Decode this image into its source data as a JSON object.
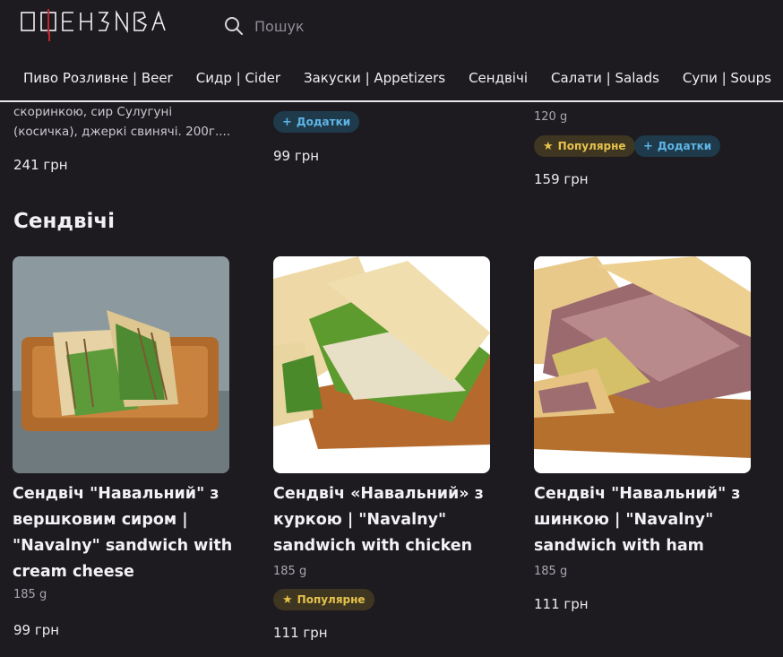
{
  "brand": {
    "logo_text": "ОФЕНЗИВА"
  },
  "search": {
    "placeholder": "Пошук"
  },
  "nav": [
    "Пиво Розливне | Beer",
    "Сидр | Cider",
    "Закуски | Appetizers",
    "Сендвічі",
    "Салати | Salads",
    "Супи | Soups"
  ],
  "prev_items": [
    {
      "desc_line1": "скоринкою, сир Сулугуні",
      "desc_line2": "(косичка), джеркі свинячі. 200г....",
      "price": "241 грн"
    },
    {
      "badge_addon": "Додатки",
      "price": "99 грн"
    },
    {
      "weight": "120 g",
      "badge_popular": "Популярне",
      "badge_addon": "Додатки",
      "price": "159 грн"
    }
  ],
  "section": {
    "title": "Сендвічі"
  },
  "products": [
    {
      "title_lines": [
        "Сендвіч \"Навальний\" з",
        "вершковим сиром |",
        "\"Navalny\" sandwich with",
        "cream cheese"
      ],
      "weight": "185 g",
      "price": "99 грн"
    },
    {
      "title_lines": [
        "Сендвіч «Навальний» з",
        "куркою | \"Navalny\"",
        "sandwich with chicken"
      ],
      "weight": "185 g",
      "badge_popular": "Популярне",
      "price": "111 грн"
    },
    {
      "title_lines": [
        "Сендвіч \"Навальний\" з",
        "шинкою | \"Navalny\"",
        "sandwich with ham"
      ],
      "weight": "185 g",
      "price": "111 грн"
    }
  ],
  "colors": {
    "background": "#1d1b20",
    "addon_text": "#5fb5e6",
    "popular_text": "#e6c24c"
  }
}
